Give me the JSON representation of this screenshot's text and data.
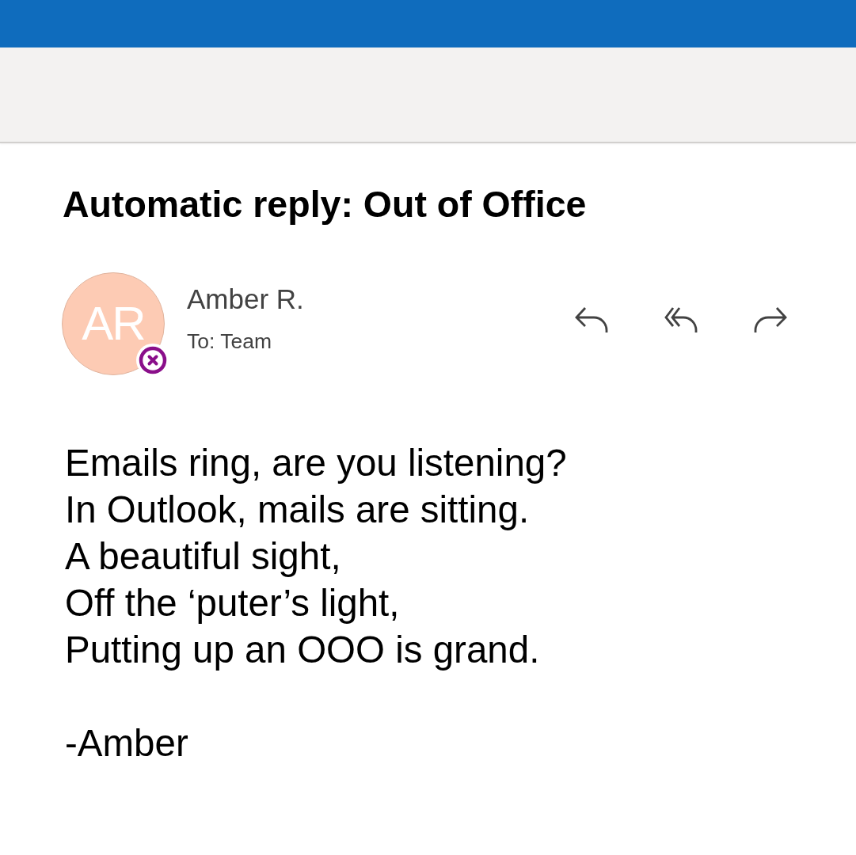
{
  "message": {
    "subject": "Automatic reply: Out of Office",
    "sender": {
      "initials": "AR",
      "name": "Amber R.",
      "presence_badge": {
        "kind": "out_of_office"
      }
    },
    "recipients": "To: Team",
    "actions": [
      {
        "kind": "reply"
      },
      {
        "kind": "reply_all"
      },
      {
        "kind": "forward"
      }
    ],
    "body": [
      {
        "lines": [
          "Emails ring, are you listening?",
          "In Outlook, mails are sitting.",
          "A beautiful sight,",
          "Off the ‘puter’s light,",
          "Putting up an OOO is grand."
        ]
      },
      {
        "lines": [
          "-Amber"
        ]
      }
    ]
  }
}
